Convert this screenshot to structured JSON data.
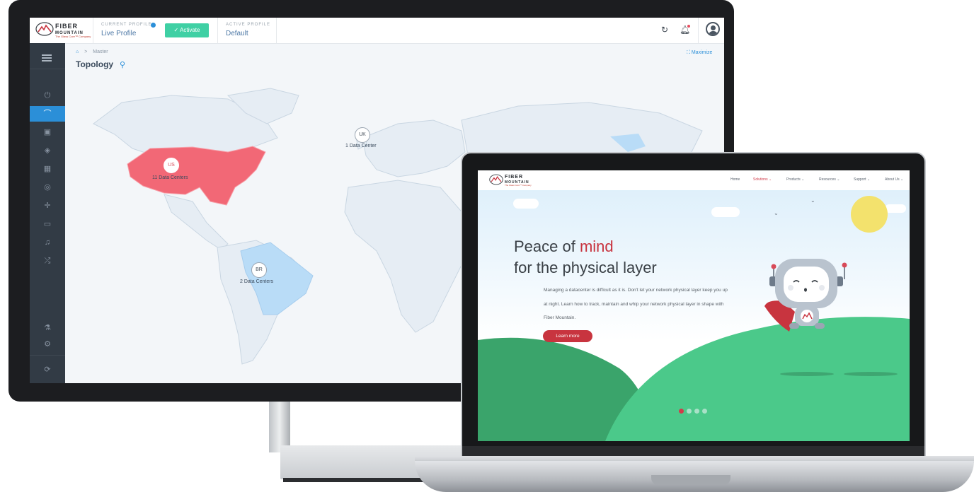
{
  "dashboard": {
    "logo": {
      "wordmark_top": "FIBER",
      "wordmark_bottom": "MOUNTAIN",
      "tagline": "The Glass Core™ Company"
    },
    "current_profile": {
      "label": "CURRENT PROFILE",
      "value": "Live Profile"
    },
    "activate_label": "✓  Activate",
    "active_profile": {
      "label": "ACTIVE PROFILE",
      "value": "Default"
    },
    "breadcrumb": {
      "home_icon": "home-icon",
      "separator": ">",
      "current": "Master"
    },
    "page_title": "Topology",
    "maximize_label": "⛶ Maximize",
    "sidebar_icons": [
      "power-icon",
      "topology-icon",
      "briefcase-icon",
      "layers-icon",
      "rack-icon",
      "compass-icon",
      "move-icon",
      "monitor-icon",
      "bell-icon",
      "shuffle-icon",
      "flask-icon",
      "settings-icon",
      "sync-icon"
    ],
    "markers": [
      {
        "code": "US",
        "count_label": "11 Data Centers"
      },
      {
        "code": "UK",
        "count_label": "1 Data Center"
      },
      {
        "code": "BR",
        "count_label": "2 Data Centers"
      }
    ],
    "colors": {
      "highlight_red": "#f26876",
      "highlight_blue": "#b9dcf7",
      "land": "#e6edf4",
      "sidebar": "#323b45",
      "accent": "#2b8fd8",
      "activate": "#3fd0a4"
    }
  },
  "website": {
    "logo": {
      "wordmark_top": "FIBER",
      "wordmark_bottom": "MOUNTAIN",
      "tagline": "The Glass Core™ Company"
    },
    "nav": [
      {
        "label": "Home",
        "active": false
      },
      {
        "label": "Solutions ⌄",
        "active": true
      },
      {
        "label": "Products ⌄",
        "active": false
      },
      {
        "label": "Resources ⌄",
        "active": false
      },
      {
        "label": "Support ⌄",
        "active": false
      },
      {
        "label": "About Us ⌄",
        "active": false
      }
    ],
    "hero": {
      "heading_part1": "Peace of ",
      "heading_accent": "mind",
      "heading_line2": "for the physical layer",
      "paragraph": "Managing a datacenter is difficult as it is.  Don't let your network physical layer keep you up at night.  Learn how to track, maintain and whip your network physical layer in shape with Fiber Mountain.",
      "cta_label": "Learn more"
    },
    "carousel": {
      "slides": 4,
      "active_index": 0
    },
    "colors": {
      "accent": "#c8343f",
      "hill_dark": "#3aa46b",
      "hill_light": "#4bc98a",
      "sun": "#f3e26d"
    }
  }
}
